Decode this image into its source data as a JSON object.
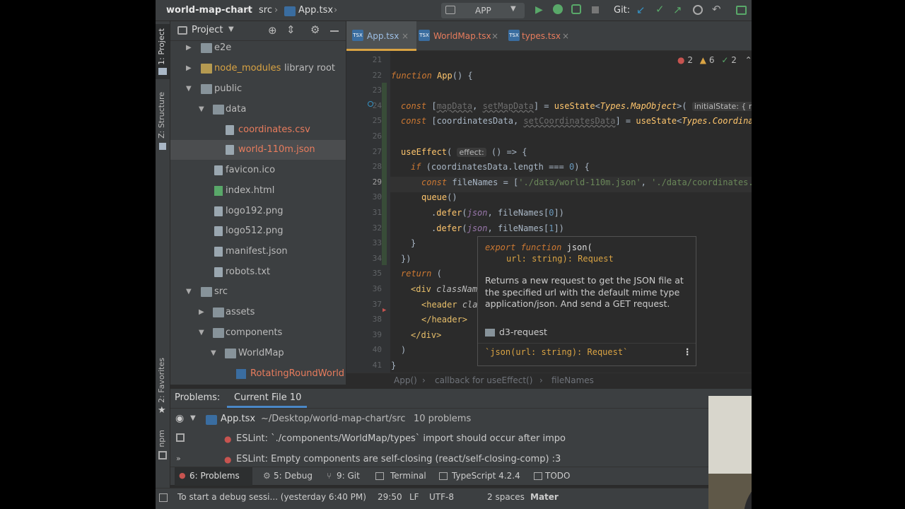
{
  "titlebar": {
    "project": "world-map-chart",
    "src": "src",
    "file": "App.tsx",
    "run_config": "APP",
    "git_label": "Git:"
  },
  "leftstrip": {
    "project_tab": "1: Project",
    "structure_tab": "Z: Structure",
    "favorites_tab": "2: Favorites",
    "npm_tab": "npm"
  },
  "project": {
    "title": "Project",
    "items": [
      {
        "label": "e2e",
        "type": "folder",
        "color": "#bbbbbb"
      },
      {
        "label": "node_modules",
        "suffix": "library root",
        "type": "folder",
        "color": "#d9a343"
      },
      {
        "label": "public",
        "type": "folder",
        "color": "#bbbbbb"
      },
      {
        "label": "data",
        "type": "folder",
        "color": "#bbbbbb"
      },
      {
        "label": "coordinates.csv",
        "type": "file",
        "color": "#e87c5d"
      },
      {
        "label": "world-110m.json",
        "type": "file",
        "color": "#e87c5d"
      },
      {
        "label": "favicon.ico",
        "type": "file",
        "color": "#bbbbbb"
      },
      {
        "label": "index.html",
        "type": "file",
        "color": "#bbbbbb"
      },
      {
        "label": "logo192.png",
        "type": "file",
        "color": "#bbbbbb"
      },
      {
        "label": "logo512.png",
        "type": "file",
        "color": "#bbbbbb"
      },
      {
        "label": "manifest.json",
        "type": "file",
        "color": "#bbbbbb"
      },
      {
        "label": "robots.txt",
        "type": "file",
        "color": "#bbbbbb"
      },
      {
        "label": "src",
        "type": "folder",
        "color": "#bbbbbb"
      },
      {
        "label": "assets",
        "type": "folder",
        "color": "#bbbbbb"
      },
      {
        "label": "components",
        "type": "folder",
        "color": "#bbbbbb"
      },
      {
        "label": "WorldMap",
        "type": "folder",
        "color": "#bbbbbb"
      },
      {
        "label": "RotatingRoundWorld",
        "type": "tsx",
        "color": "#e87c5d"
      }
    ]
  },
  "tabs": [
    {
      "label": "App.tsx",
      "color": "#9dbfe5"
    },
    {
      "label": "WorldMap.tsx",
      "color": "#e87c5d"
    },
    {
      "label": "types.tsx",
      "color": "#e87c5d"
    }
  ],
  "editor": {
    "errors": "2",
    "warnings": "6",
    "ok": "2",
    "line_numbers": [
      "21",
      "22",
      "23",
      "24",
      "25",
      "26",
      "27",
      "28",
      "29",
      "30",
      "31",
      "32",
      "33",
      "34",
      "35",
      "36",
      "37",
      "38",
      "39",
      "40",
      "41"
    ]
  },
  "popup": {
    "sig_line1_kw": "export function",
    "sig_line1_fn": "json(",
    "sig_line2": "url: string): Request",
    "description": "Returns a new request to get the JSON file at the specified url with the default mime type application/json. And send a GET request.",
    "module": "d3-request",
    "footer": "`json(url: string): Request`"
  },
  "breadcrumb": {
    "a": "App()",
    "b": "callback for useEffect()",
    "c": "fileNames"
  },
  "problems": {
    "label": "Problems:",
    "tab": "Current File 10",
    "file": "App.tsx",
    "path": "~/Desktop/world-map-chart/src",
    "count": "10 problems",
    "items": [
      "ESLint: `./components/WorldMap/types` import should occur after impo",
      "ESLint: Empty components are self-closing (react/self-closing-comp) :3"
    ]
  },
  "bottombar": {
    "problems": "6: Problems",
    "debug": "5: Debug",
    "git": "9: Git",
    "terminal": "Terminal",
    "typescript": "TypeScript 4.2.4",
    "todo": "TODO"
  },
  "statusbar": {
    "message": "To start a debug sessi... (yesterday 6:40 PM)",
    "position": "29:50",
    "line_sep": "LF",
    "encoding": "UTF-8",
    "indent": "2 spaces",
    "theme": "Mater"
  }
}
